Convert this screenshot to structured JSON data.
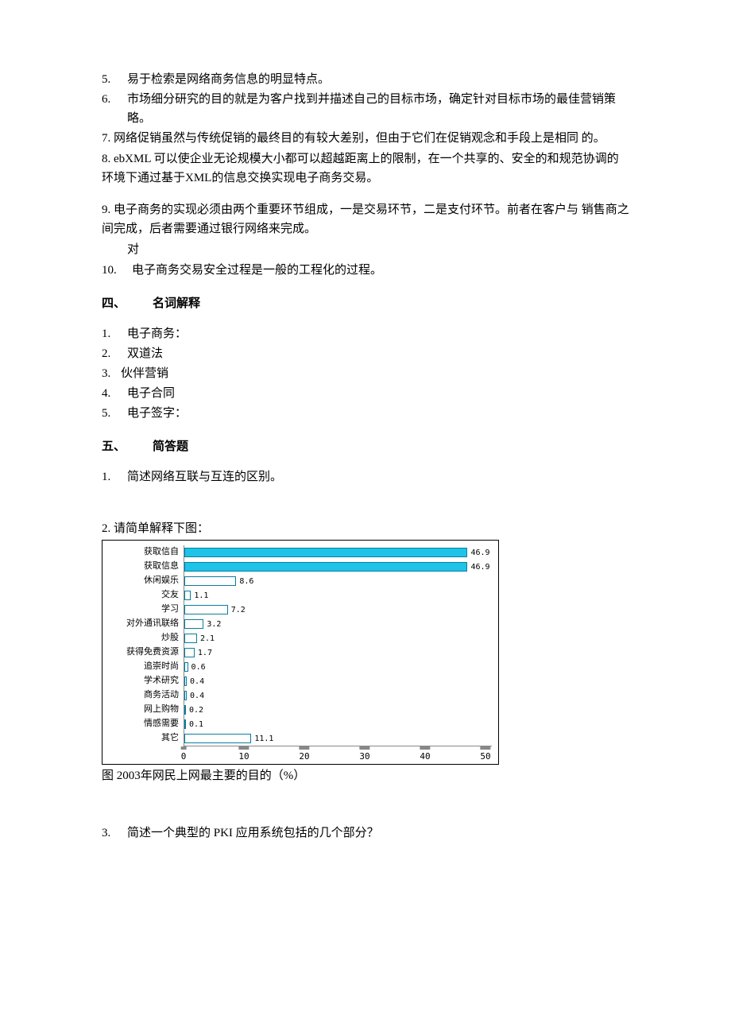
{
  "q5": {
    "num": "5.",
    "text": "易于检索是网络商务信息的明显特点。"
  },
  "q6": {
    "num": "6.",
    "text": "市场细分研究的目的就是为客户找到并描述自己的目标市场，确定针对目标市场的最佳营销策略。"
  },
  "q7": {
    "num": "7.",
    "text": "网络促销虽然与传统促销的最终目的有较大差别，但由于它们在促销观念和手段上是相同 的。"
  },
  "q8": {
    "num": "8.",
    "text": "ebXML 可以使企业无论规模大小都可以超越距离上的限制，在一个共享的、安全的和规范协调的环境下通过基于XML的信息交换实现电子商务交易。"
  },
  "q9": {
    "num": "9.",
    "text": "电子商务的实现必须由两个重要环节组成，一是交易环节，二是支付环节。前者在客户与 销售商之间完成，后者需要通过银行网络来完成。"
  },
  "q9ans": "对",
  "q10": {
    "num": "10.",
    "text": "电子商务交易安全过程是一般的工程化的过程。"
  },
  "sec4": {
    "num": "四、",
    "title": "名词解释"
  },
  "t1": {
    "num": "1.",
    "text": "电子商务："
  },
  "t2": {
    "num": "2.",
    "text": "双道法"
  },
  "t3": {
    "num": "3.",
    "text": "伙伴营销"
  },
  "t4": {
    "num": "4.",
    "text": "电子合同"
  },
  "t5": {
    "num": "5.",
    "text": "电子签字："
  },
  "sec5": {
    "num": "五、",
    "title": "简答题"
  },
  "s1": {
    "num": "1.",
    "text": "简述网络互联与互连的区别。"
  },
  "s2": {
    "num": "2.",
    "text": "请简单解释下图："
  },
  "s3": {
    "num": "3.",
    "text": "简述一个典型的 PKI 应用系统包括的几个部分？"
  },
  "chart_caption": "图 2003年网民上网最主要的目的（%）",
  "chart_data": {
    "type": "bar",
    "orientation": "horizontal",
    "categories": [
      "获取信自",
      "获取信息",
      "休闲娱乐",
      "交友",
      "学习",
      "对外通讯联络",
      "炒股",
      "获得免费资源",
      "追崇时尚",
      "学术研究",
      "商务活动",
      "网上购物",
      "情感需要",
      "其它"
    ],
    "values": [
      46.9,
      46.9,
      8.6,
      1.1,
      7.2,
      3.2,
      2.1,
      1.7,
      0.6,
      0.4,
      0.4,
      0.2,
      0.1,
      11.1
    ],
    "alt_fill": [
      false,
      false,
      true,
      true,
      true,
      true,
      true,
      true,
      true,
      true,
      true,
      true,
      true,
      true
    ],
    "xaxis": [
      0,
      10,
      20,
      30,
      40,
      50
    ],
    "xlim": [
      0,
      50
    ],
    "ylabel": "",
    "xlabel": "",
    "title": ""
  }
}
